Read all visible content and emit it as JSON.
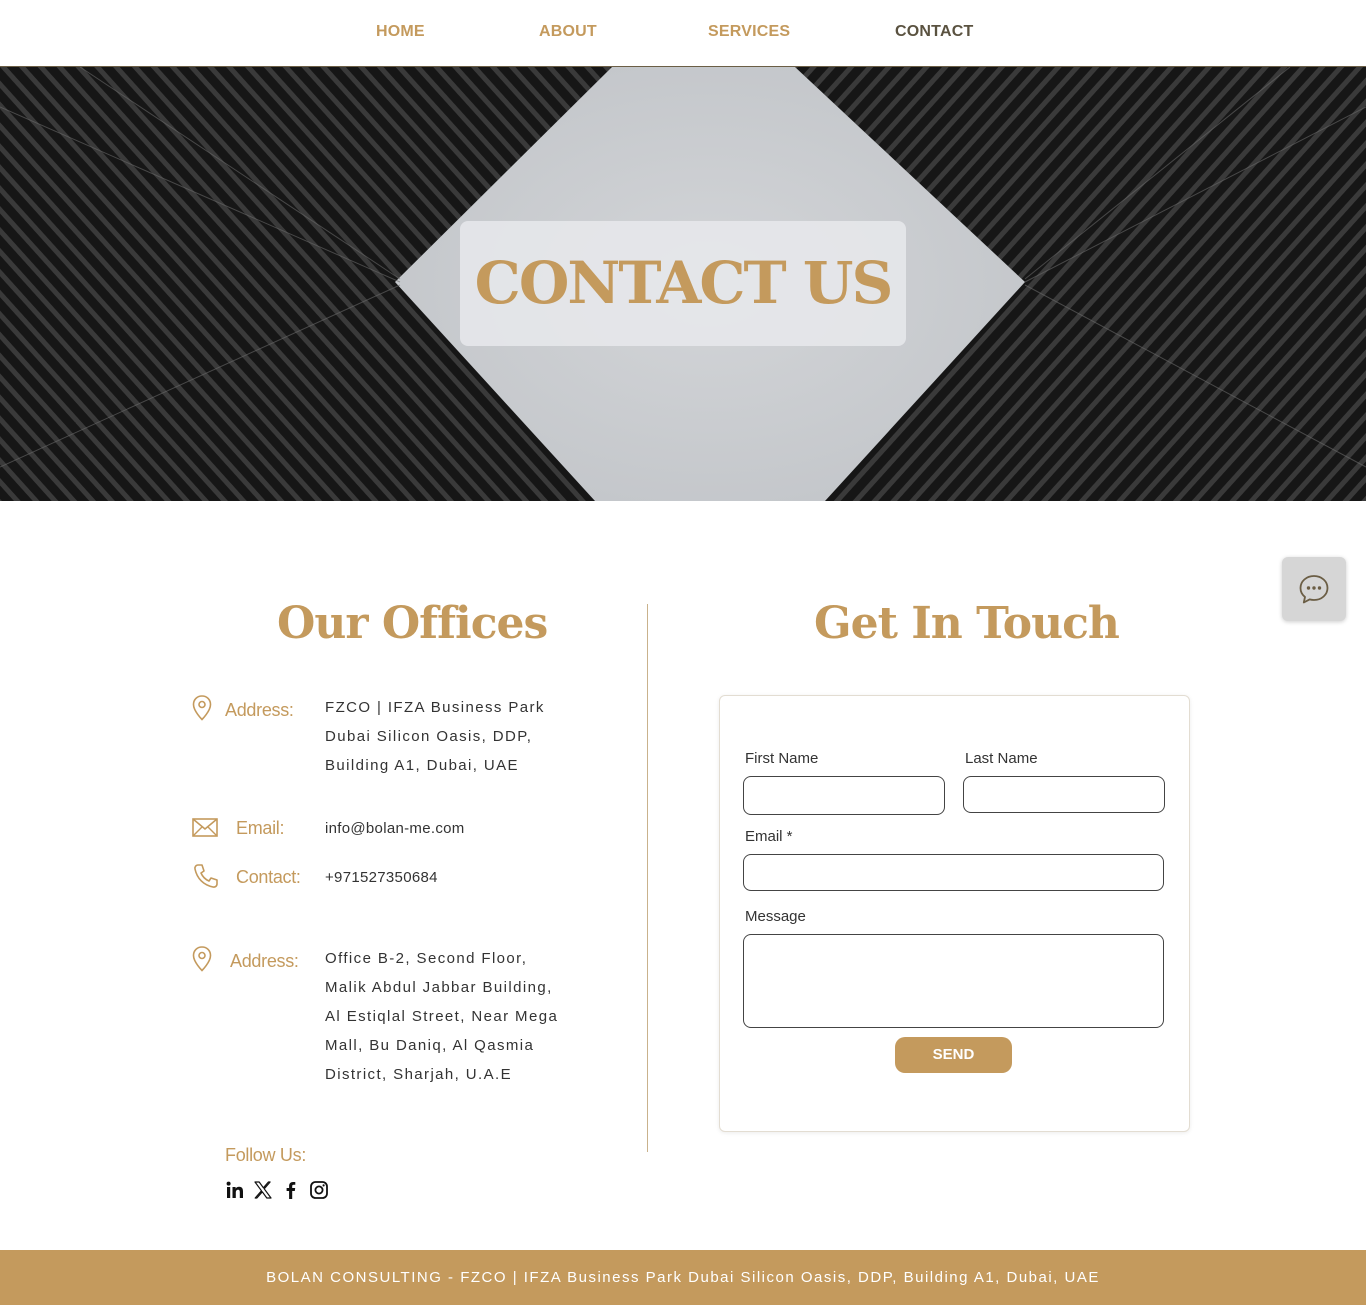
{
  "nav": {
    "home": "HOME",
    "about": "ABOUT",
    "services": "SERVICES",
    "contact": "CONTACT"
  },
  "hero": {
    "title": "CONTACT US"
  },
  "offices": {
    "title": "Our Offices",
    "address1_label": "Address:",
    "address1_lines": [
      "FZCO | IFZA Business Park",
      "Dubai Silicon Oasis, DDP,",
      "Building A1, Dubai, UAE"
    ],
    "email_label": "Email:",
    "email_value": "info@bolan-me.com",
    "contact_label": "Contact:",
    "contact_value": "+971527350684",
    "address2_label": "Address:",
    "address2_lines": [
      "Office B-2, Second Floor,",
      "Malik Abdul Jabbar Building,",
      "Al Estiqlal Street, Near Mega",
      "Mall, Bu Daniq, Al Qasmia",
      "District, Sharjah, U.A.E"
    ],
    "follow_label": "Follow Us:"
  },
  "form": {
    "title": "Get In Touch",
    "first_name_label": "First Name",
    "last_name_label": "Last Name",
    "email_label": "Email *",
    "message_label": "Message",
    "first_name_value": "",
    "last_name_value": "",
    "email_value": "",
    "message_value": "",
    "send_label": "SEND"
  },
  "social": [
    "linkedin-icon",
    "x-icon",
    "facebook-icon",
    "instagram-icon"
  ],
  "footer": {
    "text": "BOLAN CONSULTING - FZCO | IFZA Business Park Dubai Silicon Oasis, DDP, Building A1, Dubai, UAE"
  },
  "colors": {
    "accent": "#c49a5d",
    "nav_active": "#5a5240",
    "footer_bg": "#c49a5d"
  }
}
